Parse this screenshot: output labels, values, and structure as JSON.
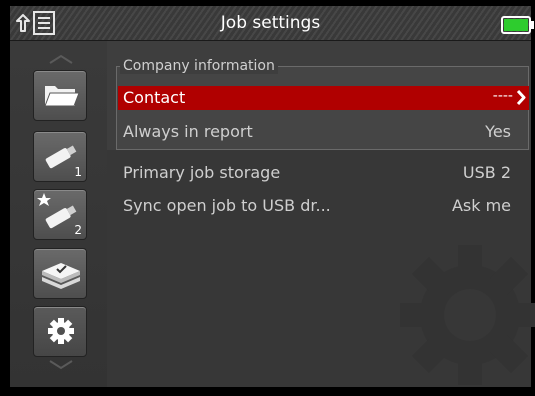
{
  "header": {
    "title": "Job settings",
    "battery_color": "#2ecc2e"
  },
  "nav": {
    "items": [
      {
        "icon": "folder-icon"
      },
      {
        "icon": "usb-drive-icon",
        "number": "1"
      },
      {
        "icon": "starred-usb-drive-icon",
        "number": "2"
      },
      {
        "icon": "disk-stack-icon"
      },
      {
        "icon": "gear-icon",
        "selected": true
      }
    ]
  },
  "settings": {
    "group_title": "Company information",
    "rows": [
      {
        "label": "Contact",
        "value": "----",
        "highlighted": true
      },
      {
        "label": "Always in report",
        "value": "Yes"
      },
      {
        "label": "Primary job storage",
        "value": "USB 2"
      },
      {
        "label": "Sync open job to USB dr...",
        "value": "Ask me"
      }
    ]
  },
  "colors": {
    "highlight": "#b00000",
    "background": "#3e3e3e"
  }
}
